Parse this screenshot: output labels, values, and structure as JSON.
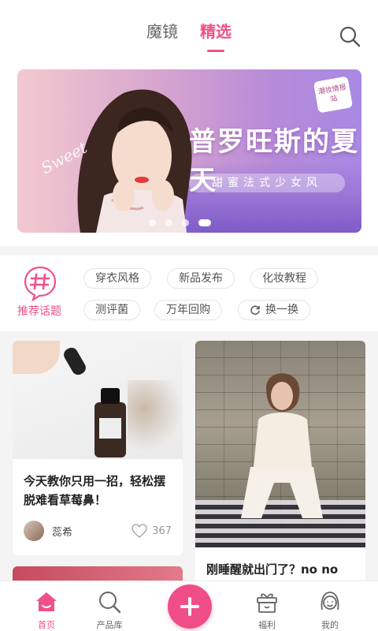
{
  "header": {
    "tabs": [
      {
        "label": "魔镜",
        "active": false
      },
      {
        "label": "精选",
        "active": true
      }
    ],
    "search_icon": "search-icon"
  },
  "banner": {
    "sweet": "Sweet",
    "title": "普罗旺斯的夏天",
    "subtitle": "甜蜜法式少女风",
    "badge": "潮妆情报站",
    "slide_count": 4,
    "active_slide": 4
  },
  "topics": {
    "title": "推荐话题",
    "icon": "hashtag-icon",
    "chips": [
      "穿衣风格",
      "新品发布",
      "化妆教程",
      "测评菌",
      "万年回购"
    ],
    "refresh_label": "换一换"
  },
  "feed": {
    "posts": [
      {
        "title": "今天教你只用一招，轻松摆脱难看草莓鼻！",
        "author": "蕊希",
        "likes": "367"
      },
      {
        "title": "刚睡醒就出门了？no no"
      }
    ]
  },
  "bottom_nav": {
    "items": [
      {
        "label": "首页",
        "icon": "home-icon",
        "active": true
      },
      {
        "label": "产品库",
        "icon": "search-icon",
        "active": false
      },
      {
        "label": "福利",
        "icon": "gift-icon",
        "active": false
      },
      {
        "label": "我的",
        "icon": "profile-icon",
        "active": false
      }
    ],
    "create_icon": "plus-icon"
  },
  "colors": {
    "accent": "#f0508a",
    "background": "#f4f4f4"
  }
}
